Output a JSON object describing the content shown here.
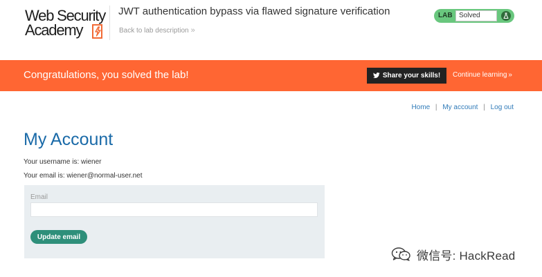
{
  "header": {
    "logo_line1": "Web Security",
    "logo_line2": "Academy",
    "lab_title": "JWT authentication bypass via flawed signature verification",
    "back_link_label": "Back to lab description",
    "back_link_chevron": "»",
    "status_tag": "LAB",
    "status_value": "Solved"
  },
  "banner": {
    "message": "Congratulations, you solved the lab!",
    "share_label": "Share your skills!",
    "continue_label": "Continue learning",
    "continue_chevron": "»",
    "background_color": "#ff6633"
  },
  "nav": {
    "items": [
      "Home",
      "My account",
      "Log out"
    ],
    "separator": "|"
  },
  "account": {
    "title": "My Account",
    "username_line": "Your username is: wiener",
    "email_line": "Your email is: wiener@normal-user.net"
  },
  "form": {
    "email_label": "Email",
    "email_value": "",
    "update_button": "Update email"
  },
  "watermark": {
    "text": "微信号: HackRead"
  },
  "colors": {
    "accent_orange": "#ff6633",
    "link_blue": "#2f7ab8",
    "title_blue": "#1a6aa8",
    "solved_green": "#69c77e",
    "button_teal": "#2e8f7a"
  },
  "icons": {
    "logo_bolt": "lightning-bolt-icon",
    "status": "flask-icon",
    "share": "twitter-bird-icon",
    "watermark": "wechat-icon"
  }
}
